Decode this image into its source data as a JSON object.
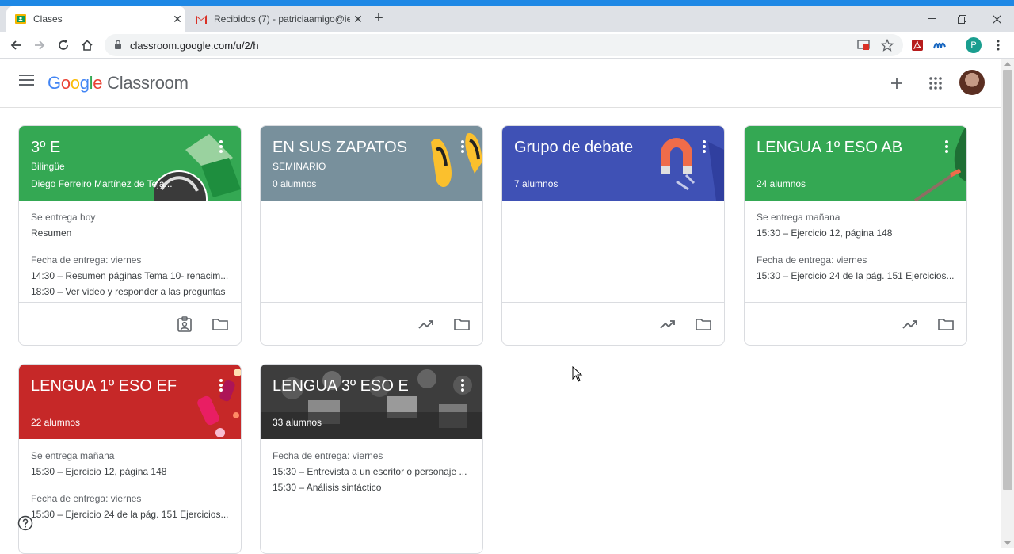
{
  "browser": {
    "tabs": [
      {
        "title": "Clases",
        "active": true
      },
      {
        "title": "Recibidos (7) - patriciaamigo@ie",
        "active": false
      }
    ],
    "url": "classroom.google.com/u/2/h",
    "profile_initial": "P"
  },
  "app": {
    "logo_google": "Google",
    "logo_product": "Classroom"
  },
  "colors": {
    "green": "#34a853",
    "slate": "#78909c",
    "indigo": "#3f51b5",
    "red": "#c62828",
    "dark": "#424242"
  },
  "cards": [
    {
      "title": "3º E",
      "subtitle": "Bilingüe",
      "teacher": "Diego Ferreiro Martínez de Teja...",
      "due_groups": [
        {
          "heading": "Se entrega hoy",
          "items": [
            "Resumen"
          ]
        },
        {
          "heading": "Fecha de entrega: viernes",
          "items": [
            "14:30 – Resumen páginas Tema 10- renacim...",
            "18:30 – Ver video y responder a las preguntas"
          ]
        }
      ],
      "footer_icons": [
        "assignment-ind-icon",
        "folder-icon"
      ]
    },
    {
      "title": "EN SUS ZAPATOS",
      "subtitle": "SEMINARIO",
      "count": "0 alumnos",
      "footer_icons": [
        "trending-up-icon",
        "folder-icon"
      ]
    },
    {
      "title": "Grupo de debate",
      "count": "7 alumnos",
      "footer_icons": [
        "trending-up-icon",
        "folder-icon"
      ]
    },
    {
      "title": "LENGUA 1º ESO AB",
      "count": "24 alumnos",
      "due_groups": [
        {
          "heading": "Se entrega mañana",
          "items": [
            "15:30 – Ejercicio 12, página 148"
          ]
        },
        {
          "heading": "Fecha de entrega: viernes",
          "items": [
            "15:30 – Ejercicio 24 de la pág. 151 Ejercicios..."
          ]
        }
      ],
      "footer_icons": [
        "trending-up-icon",
        "folder-icon"
      ]
    },
    {
      "title": "LENGUA 1º ESO EF",
      "count": "22 alumnos",
      "due_groups": [
        {
          "heading": "Se entrega mañana",
          "items": [
            "15:30 – Ejercicio 12, página 148"
          ]
        },
        {
          "heading": "Fecha de entrega: viernes",
          "items": [
            "15:30 – Ejercicio 24 de la pág. 151 Ejercicios..."
          ]
        }
      ]
    },
    {
      "title": "LENGUA 3º ESO E",
      "count": "33 alumnos",
      "due_groups": [
        {
          "heading": "Fecha de entrega: viernes",
          "items": [
            "15:30 – Entrevista a un escritor o personaje ...",
            "15:30 – Análisis sintáctico"
          ]
        }
      ]
    }
  ]
}
